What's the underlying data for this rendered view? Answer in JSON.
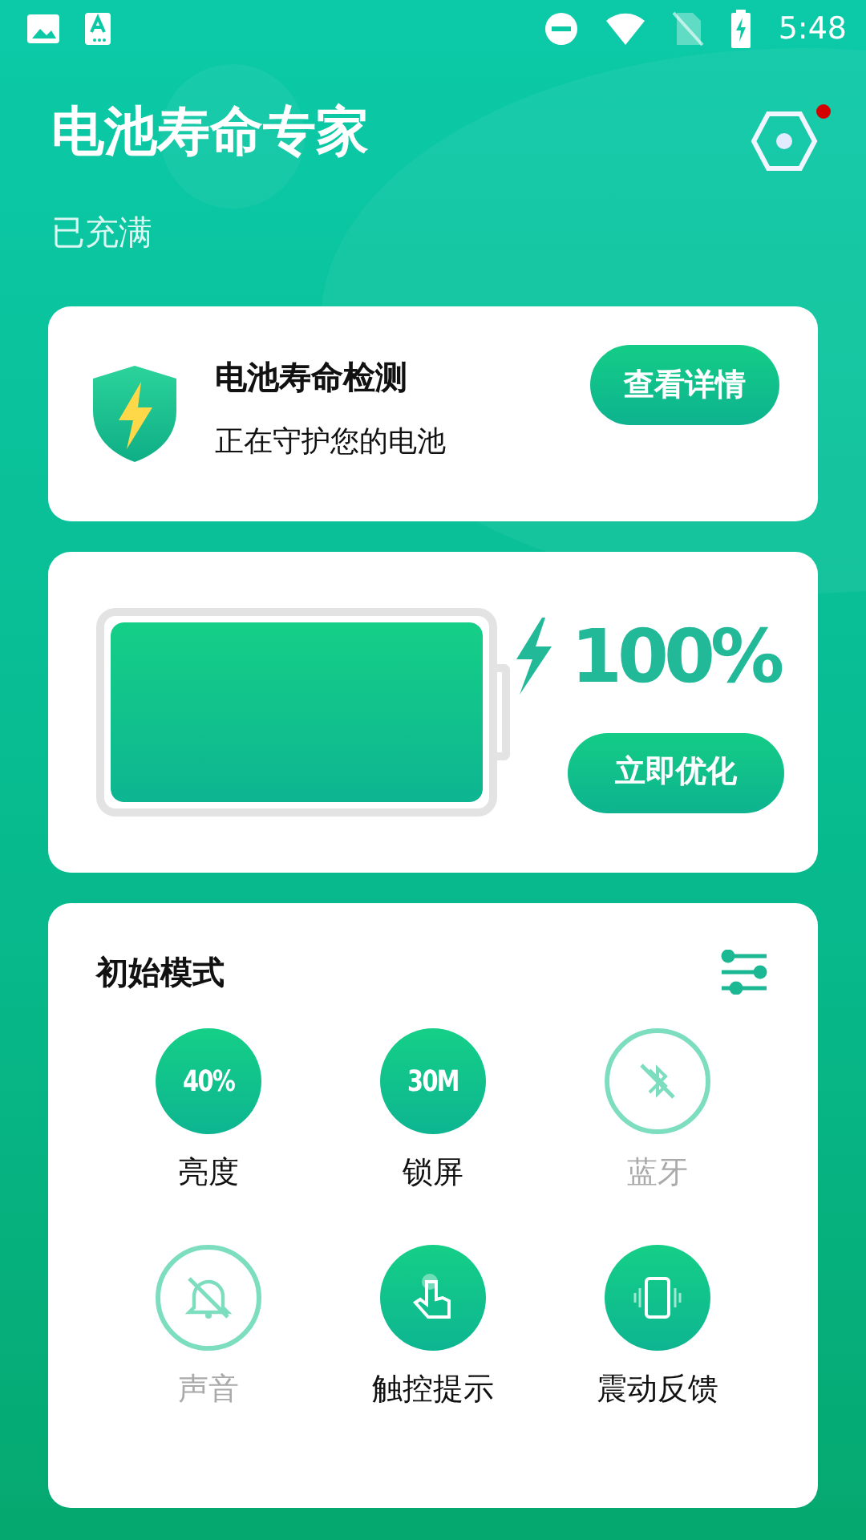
{
  "status_bar": {
    "time": "5:48"
  },
  "header": {
    "title": "电池寿命专家",
    "subtitle": "已充满",
    "settings_notification": true
  },
  "protection_card": {
    "title": "电池寿命检测",
    "subtitle": "正在守护您的电池",
    "button": "查看详情"
  },
  "battery_card": {
    "level": 1,
    "reading": "100%",
    "button": "立即优化"
  },
  "mode_card": {
    "title": "初始模式",
    "items": [
      {
        "label": "亮度",
        "kind": "value",
        "value": "40%",
        "on": true
      },
      {
        "label": "锁屏",
        "kind": "value",
        "value": "30M",
        "on": true
      },
      {
        "label": "蓝牙",
        "kind": "bluetooth",
        "on": false
      },
      {
        "label": "声音",
        "kind": "bell",
        "on": false
      },
      {
        "label": "触控提示",
        "kind": "touch",
        "on": true
      },
      {
        "label": "震动反馈",
        "kind": "vibrate",
        "on": true
      }
    ]
  }
}
